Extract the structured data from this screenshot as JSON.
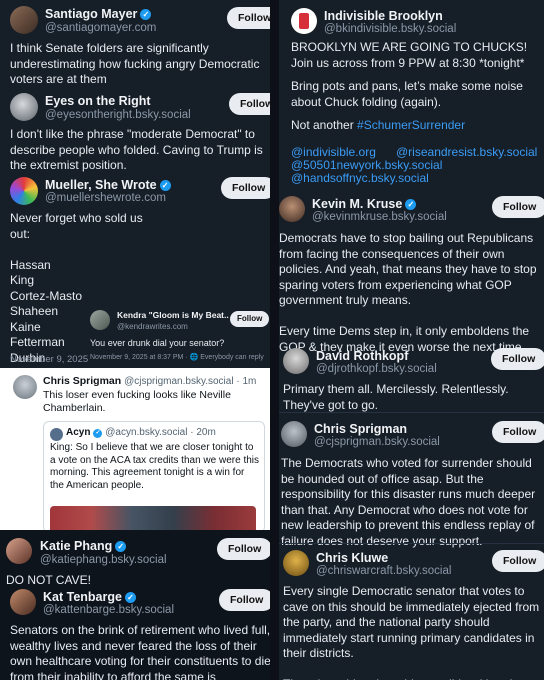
{
  "left_top": {
    "posts": [
      {
        "name": "Santiago Mayer",
        "verified": true,
        "handle": "@santiagomayer.com",
        "follow": "Follow",
        "text": "I think Senate folders are significantly underestimating how fucking angry Democratic voters are at them"
      },
      {
        "name": "Eyes on the Right",
        "verified": false,
        "handle": "@eyesontheright.bsky.social",
        "follow": "Follow",
        "text": "I don't like the phrase \"moderate Democrat\" to describe people who folded. Caving to Trump is the extremist position."
      },
      {
        "name": "Mueller, She Wrote",
        "verified": true,
        "handle": "@muellershewrote.com",
        "follow": "Follow",
        "text": "Never forget who sold us out:\n\nHassan\nKing\nCortez-Masto\nShaheen\nKaine\nFetterman\nDurbin\nRosen",
        "date": "November 9, 2025"
      }
    ],
    "reply": {
      "name": "Kendra \"Gloom is My Beat..",
      "handle": "@kendrawrites.com",
      "follow": "Follow",
      "text": "You ever drunk dial your senator?",
      "meta": "November 9, 2025 at 8:37 PM · 🌐 Everybody can reply"
    }
  },
  "left_mid": {
    "name": "Chris Sprigman",
    "handle": "@cjsprigman.bsky.social · 1m",
    "text": "This loser even fucking looks like Neville Chamberlain.",
    "quote": {
      "name": "Acyn",
      "verified": true,
      "handle": "@acyn.bsky.social · 20m",
      "text": "King: So I believe that we are closer tonight to a vote on the ACA tax credits than we were this morning. This agreement tonight is a win for the American people."
    }
  },
  "left_bottom": {
    "posts": [
      {
        "name": "Katie Phang",
        "verified": true,
        "handle": "@katiephang.bsky.social",
        "follow": "Follow",
        "text": "DO NOT CAVE!"
      },
      {
        "name": "Kat Tenbarge",
        "verified": true,
        "handle": "@kattenbarge.bsky.social",
        "follow": "Follow",
        "text": "Senators on the brink of retirement who lived full, wealthy lives and never feared the loss of their own healthcare voting for their constituents to die from their inability to afford the same is treasonous"
      }
    ]
  },
  "right": {
    "top": {
      "name": "Indivisible Brooklyn",
      "handle": "@bkindivisible.bsky.social",
      "line1": "BROOKLYN WE ARE GOING TO CHUCKS! Join us across from 9 PPW at 8:30 *tonight*",
      "line2": "Bring pots and pans, let’s make some noise about Chuck folding (again).",
      "line3": "Not another ",
      "hashtag": "#SchumerSurrender",
      "links": [
        "@indivisible.org",
        "@riseandresist.bsky.social",
        "@50501newyork.bsky.social",
        "@handsoffnyc.bsky.social"
      ]
    },
    "posts": [
      {
        "name": "Kevin M. Kruse",
        "verified": true,
        "handle": "@kevinmkruse.bsky.social",
        "follow": "Follow",
        "text": "Democrats have to stop bailing out Republicans from facing the consequences of their own policies. And yeah, that means they have to stop sparing voters from experiencing what GOP government truly means.\n\nEvery time Dems step in, it only emboldens the GOP & they make it even worse the next time."
      },
      {
        "name": "David Rothkopf",
        "verified": false,
        "handle": "@djrothkopf.bsky.social",
        "follow": "Follow",
        "text": "Primary them all. Mercilessly. Relentlessly. They've got to go."
      },
      {
        "name": "Chris Sprigman",
        "verified": false,
        "handle": "@cjsprigman.bsky.social",
        "follow": "Follow",
        "text": "The Democrats who voted for surrender should be hounded out of office asap. But the responsibility for this disaster runs much deeper than that. Any Democrat who does not vote for new leadership to prevent this endless replay of failure does not deserve your support."
      },
      {
        "name": "Chris Kluwe",
        "verified": false,
        "handle": "@chriswarcraft.bsky.social",
        "follow": "Follow",
        "text": "Every single Democratic senator that votes to cave on this should be immediately ejected from the party, and the national party should immediately start running primary candidates in their districts.\n\nThere is no bipartisanship possible with traitors and fascists. You either fight, or die."
      }
    ]
  },
  "colors": {
    "accent": "#1d9bf0",
    "link": "#3b9cf5",
    "bg": "#161e27"
  }
}
